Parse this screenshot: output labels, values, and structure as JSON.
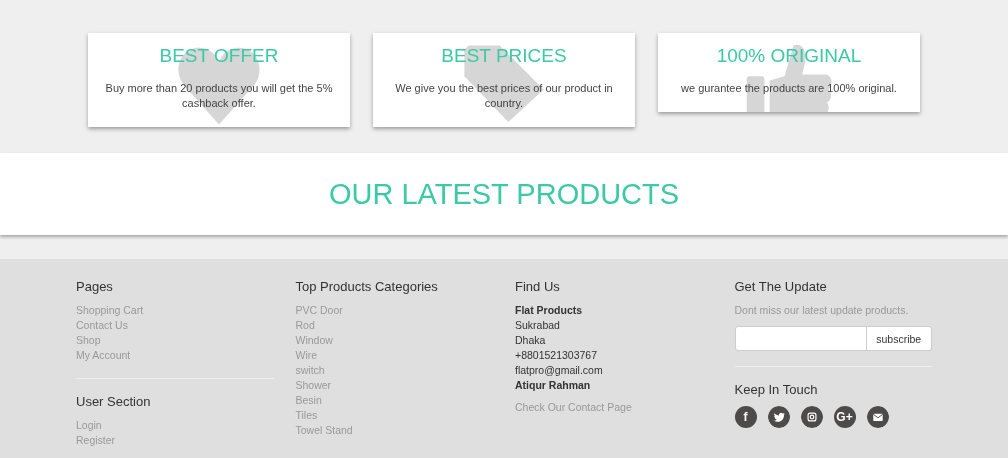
{
  "features": [
    {
      "kind": "heart",
      "title": "BEST OFFER",
      "text": "Buy more than 20 products you will get the 5% cashback offer."
    },
    {
      "kind": "tag",
      "title": "BEST PRICES",
      "text": "We give you the best prices of our product in country."
    },
    {
      "kind": "thumbs-up",
      "title": "100% ORIGINAL",
      "text": "we gurantee the products are 100% original."
    }
  ],
  "latest": {
    "title": "OUR LATEST PRODUCTS"
  },
  "footer": {
    "pages": {
      "title": "Pages",
      "links": [
        "Shopping Cart",
        "Contact Us",
        "Shop",
        "My Account"
      ]
    },
    "user_section": {
      "title": "User Section",
      "links": [
        "Login",
        "Register"
      ]
    },
    "categories": {
      "title": "Top Products Categories",
      "links": [
        "PVC Door",
        "Rod",
        "Window",
        "Wire",
        "switch",
        "Shower",
        "Besin",
        "Tiles",
        "Towel Stand"
      ]
    },
    "find_us": {
      "title": "Find Us",
      "lines": [
        {
          "kind": "bold",
          "text": "Flat Products"
        },
        {
          "kind": "plain",
          "text": "Sukrabad"
        },
        {
          "kind": "plain",
          "text": "Dhaka"
        },
        {
          "kind": "plain",
          "text": "+8801521303767"
        },
        {
          "kind": "plain",
          "text": "flatpro@gmail.com"
        },
        {
          "kind": "bold",
          "text": "Atiqur Rahman"
        }
      ],
      "link": "Check Our Contact Page"
    },
    "update": {
      "title": "Get The Update",
      "text": "Dont miss our latest update products.",
      "button": "subscribe"
    },
    "touch": {
      "title": "Keep In Touch",
      "icons": [
        {
          "kind": "facebook",
          "glyph": "f"
        },
        {
          "kind": "twitter"
        },
        {
          "kind": "instagram"
        },
        {
          "kind": "google-plus",
          "glyph": "G+"
        },
        {
          "kind": "mail"
        }
      ]
    }
  }
}
